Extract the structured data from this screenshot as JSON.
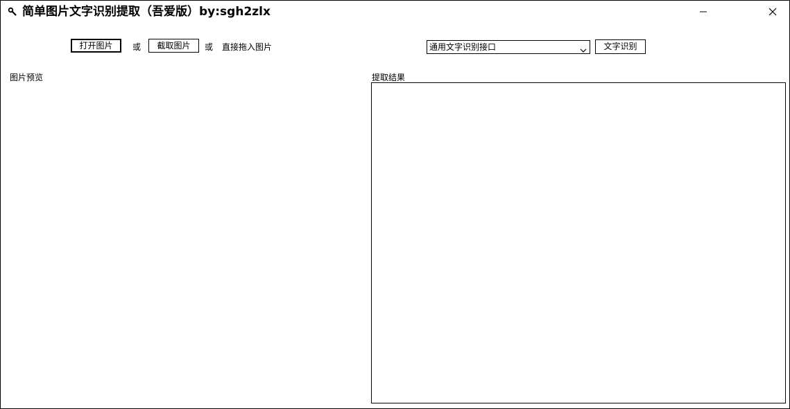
{
  "window": {
    "title": "简单图片文字识别提取（吾爱版）by:sgh2zlx"
  },
  "toolbar": {
    "open_image_label": "打开图片",
    "or_label_1": "或",
    "capture_image_label": "截取图片",
    "or_label_2": "或",
    "drag_hint": "直接拖入图片",
    "api_select_value": "通用文字识别接口",
    "recognize_label": "文字识别"
  },
  "panels": {
    "preview_label": "图片预览",
    "result_label": "提取结果"
  },
  "icons": {
    "app": "search-icon",
    "minimize": "minimize-icon",
    "close": "close-icon",
    "dropdown": "chevron-down-icon"
  }
}
